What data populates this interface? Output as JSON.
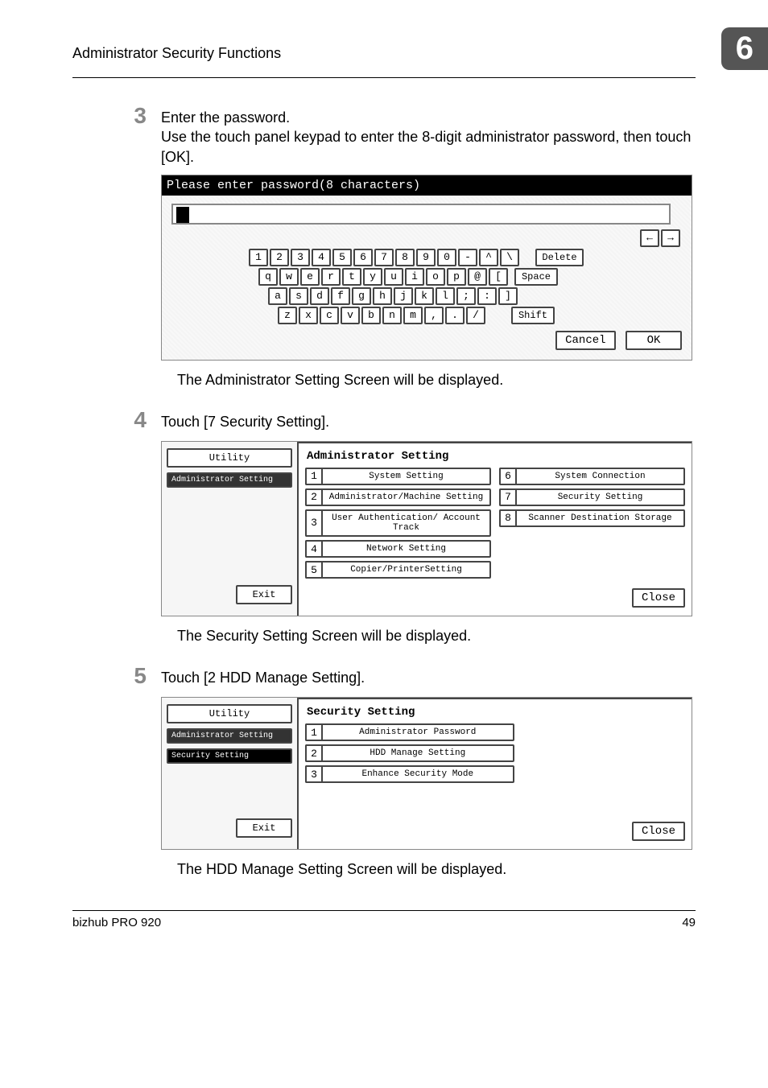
{
  "header": {
    "title": "Administrator Security Functions",
    "chapter": "6"
  },
  "steps": {
    "s3": {
      "num": "3",
      "line1": "Enter the password.",
      "line2": "Use the touch panel keypad to enter the 8-digit administrator password, then touch [OK]."
    },
    "s4": {
      "num": "4",
      "line1": "Touch [7 Security Setting]."
    },
    "s5": {
      "num": "5",
      "line1": "Touch [2 HDD Manage Setting]."
    }
  },
  "captions": {
    "c1": "The Administrator Setting Screen will be displayed.",
    "c2": "The Security Setting Screen will be displayed.",
    "c3": "The HDD Manage Setting Screen will be displayed."
  },
  "password_screen": {
    "title": "Please enter password(8 characters)",
    "arrows": {
      "left": "←",
      "right": "→"
    },
    "delete": "Delete",
    "space": "Space",
    "shift": "Shift",
    "row1": [
      "1",
      "2",
      "3",
      "4",
      "5",
      "6",
      "7",
      "8",
      "9",
      "0",
      "-",
      "^",
      "\\"
    ],
    "row2": [
      "q",
      "w",
      "e",
      "r",
      "t",
      "y",
      "u",
      "i",
      "o",
      "p",
      "@",
      "["
    ],
    "row3": [
      "a",
      "s",
      "d",
      "f",
      "g",
      "h",
      "j",
      "k",
      "l",
      ";",
      ":",
      "]"
    ],
    "row4": [
      "z",
      "x",
      "c",
      "v",
      "b",
      "n",
      "m",
      ",",
      ".",
      "/"
    ],
    "cancel": "Cancel",
    "ok": "OK"
  },
  "admin_screen": {
    "utility": "Utility",
    "admin_setting_nav": "Administrator Setting",
    "exit": "Exit",
    "close": "Close",
    "panel_title": "Administrator Setting",
    "options_left": [
      {
        "n": "1",
        "label": "System Setting"
      },
      {
        "n": "2",
        "label": "Administrator/Machine Setting"
      },
      {
        "n": "3",
        "label": "User Authentication/ Account Track"
      },
      {
        "n": "4",
        "label": "Network Setting"
      },
      {
        "n": "5",
        "label": "Copier/PrinterSetting"
      }
    ],
    "options_right": [
      {
        "n": "6",
        "label": "System Connection"
      },
      {
        "n": "7",
        "label": "Security Setting"
      },
      {
        "n": "8",
        "label": "Scanner Destination Storage"
      }
    ]
  },
  "security_screen": {
    "utility": "Utility",
    "admin_setting_nav": "Administrator Setting",
    "security_setting_nav": "Security Setting",
    "exit": "Exit",
    "close": "Close",
    "panel_title": "Security Setting",
    "options": [
      {
        "n": "1",
        "label": "Administrator Password"
      },
      {
        "n": "2",
        "label": "HDD Manage Setting"
      },
      {
        "n": "3",
        "label": "Enhance Security Mode"
      }
    ]
  },
  "footer": {
    "left": "bizhub PRO 920",
    "right": "49"
  }
}
